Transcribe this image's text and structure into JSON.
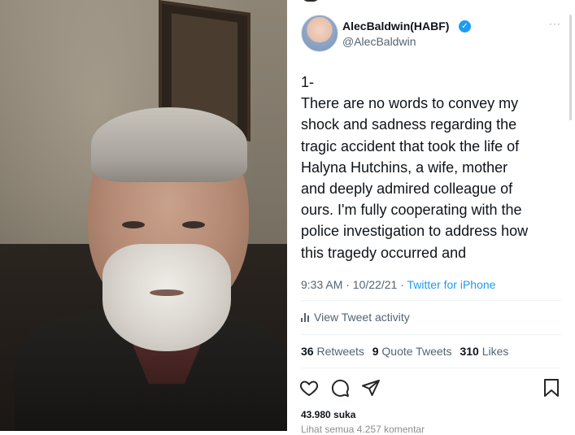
{
  "tweet": {
    "display_name": "AlecBaldwin(HABF)",
    "handle": "@AlecBaldwin",
    "more_label": "···",
    "verified_glyph": "✓",
    "text_lines": [
      "1-",
      "There are no words to convey my",
      "shock and sadness regarding the",
      "tragic accident that took the life of",
      "Halyna Hutchins, a wife, mother",
      "and deeply admired colleague of",
      "ours. I'm fully cooperating with the",
      "police investigation to address how",
      "this tragedy occurred and"
    ],
    "time": "9:33 AM · 10/22/21 · ",
    "source": "Twitter for iPhone",
    "activity_label": "View Tweet activity",
    "retweets_count": "36",
    "retweets_label": "Retweets",
    "quotes_count": "9",
    "quotes_label": "Quote Tweets",
    "likes_count": "310",
    "likes_label": "Likes"
  },
  "post": {
    "likes_text": "43.980 suka",
    "comments_text": "Lihat semua 4.257 komentar"
  },
  "icons": [
    "heart-icon",
    "comment-icon",
    "share-icon",
    "bookmark-icon",
    "verified-icon",
    "bar-chart-icon"
  ],
  "colors": {
    "link": "#1d9bf0",
    "muted": "#536471",
    "text": "#0f1419"
  }
}
